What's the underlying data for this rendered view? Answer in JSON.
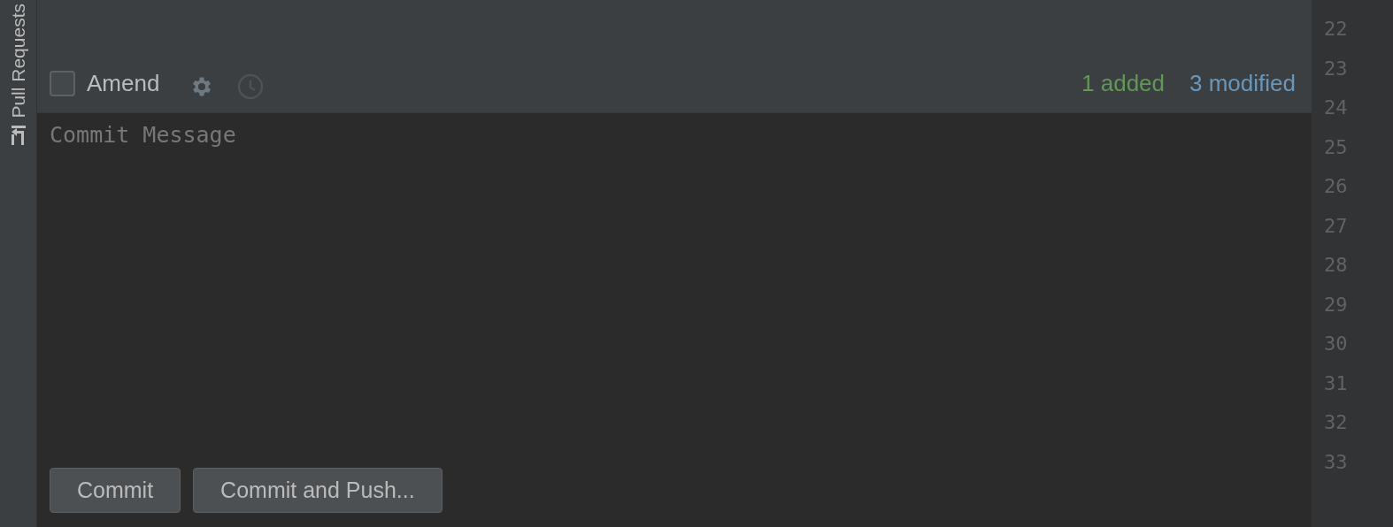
{
  "sidebar": {
    "tab": {
      "label": "Pull Requests"
    }
  },
  "toolbar": {
    "amend": {
      "label": "Amend",
      "checked": false
    },
    "added": "1 added",
    "modified": "3 modified"
  },
  "commit_message": {
    "placeholder": "Commit Message"
  },
  "buttons": [
    "Commit",
    "Commit and Push..."
  ],
  "gutter": {
    "line_numbers": [
      "22",
      "23",
      "24",
      "25",
      "26",
      "27",
      "28",
      "29",
      "30",
      "31",
      "32",
      "33"
    ]
  }
}
